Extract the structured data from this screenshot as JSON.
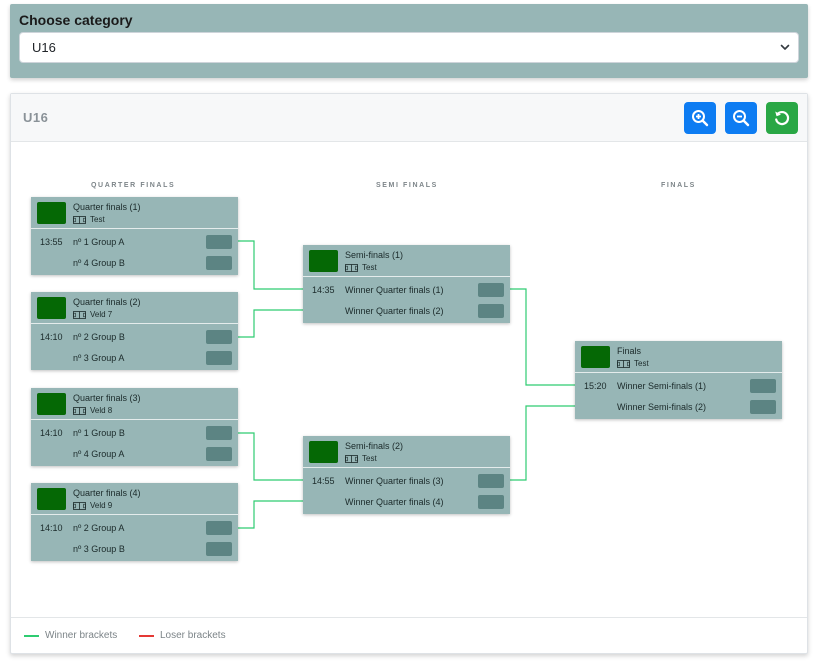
{
  "category": {
    "label": "Choose category",
    "selected": "U16"
  },
  "bracket": {
    "title": "U16",
    "round_labels": {
      "quarter": "QUARTER FINALS",
      "semi": "SEMI FINALS",
      "final": "FINALS"
    },
    "matches": {
      "qf1": {
        "title": "Quarter finals (1)",
        "venue": "Test",
        "time": "13:55",
        "team1": "nº 1 Group A",
        "team2": "nº 4 Group B"
      },
      "qf2": {
        "title": "Quarter finals (2)",
        "venue": "Veld 7",
        "time": "14:10",
        "team1": "nº 2 Group B",
        "team2": "nº 3 Group A"
      },
      "qf3": {
        "title": "Quarter finals (3)",
        "venue": "Veld 8",
        "time": "14:10",
        "team1": "nº 1 Group B",
        "team2": "nº 4 Group A"
      },
      "qf4": {
        "title": "Quarter finals (4)",
        "venue": "Veld 9",
        "time": "14:10",
        "team1": "nº 2 Group A",
        "team2": "nº 3 Group B"
      },
      "sf1": {
        "title": "Semi-finals (1)",
        "venue": "Test",
        "time": "14:35",
        "team1": "Winner Quarter finals (1)",
        "team2": "Winner Quarter finals (2)"
      },
      "sf2": {
        "title": "Semi-finals (2)",
        "venue": "Test",
        "time": "14:55",
        "team1": "Winner Quarter finals (3)",
        "team2": "Winner Quarter finals (4)"
      },
      "f1": {
        "title": "Finals",
        "venue": "Test",
        "time": "15:20",
        "team1": "Winner Semi-finals (1)",
        "team2": "Winner Semi-finals (2)"
      }
    }
  },
  "legend": {
    "winner": "Winner brackets",
    "loser": "Loser brackets"
  },
  "colors": {
    "panel": "#97b6b6",
    "team_logo": "#056805",
    "score_box": "#5c8483",
    "winner_line": "#2ecc71",
    "loser_line": "#e53935",
    "zoom_button": "#0d7cf2",
    "reset_button": "#29a745"
  },
  "icons": {
    "zoom_in": "zoom-in-icon",
    "zoom_out": "zoom-out-icon",
    "reset": "reset-icon",
    "venue": "field-icon",
    "dropdown": "chevron-down-icon"
  }
}
